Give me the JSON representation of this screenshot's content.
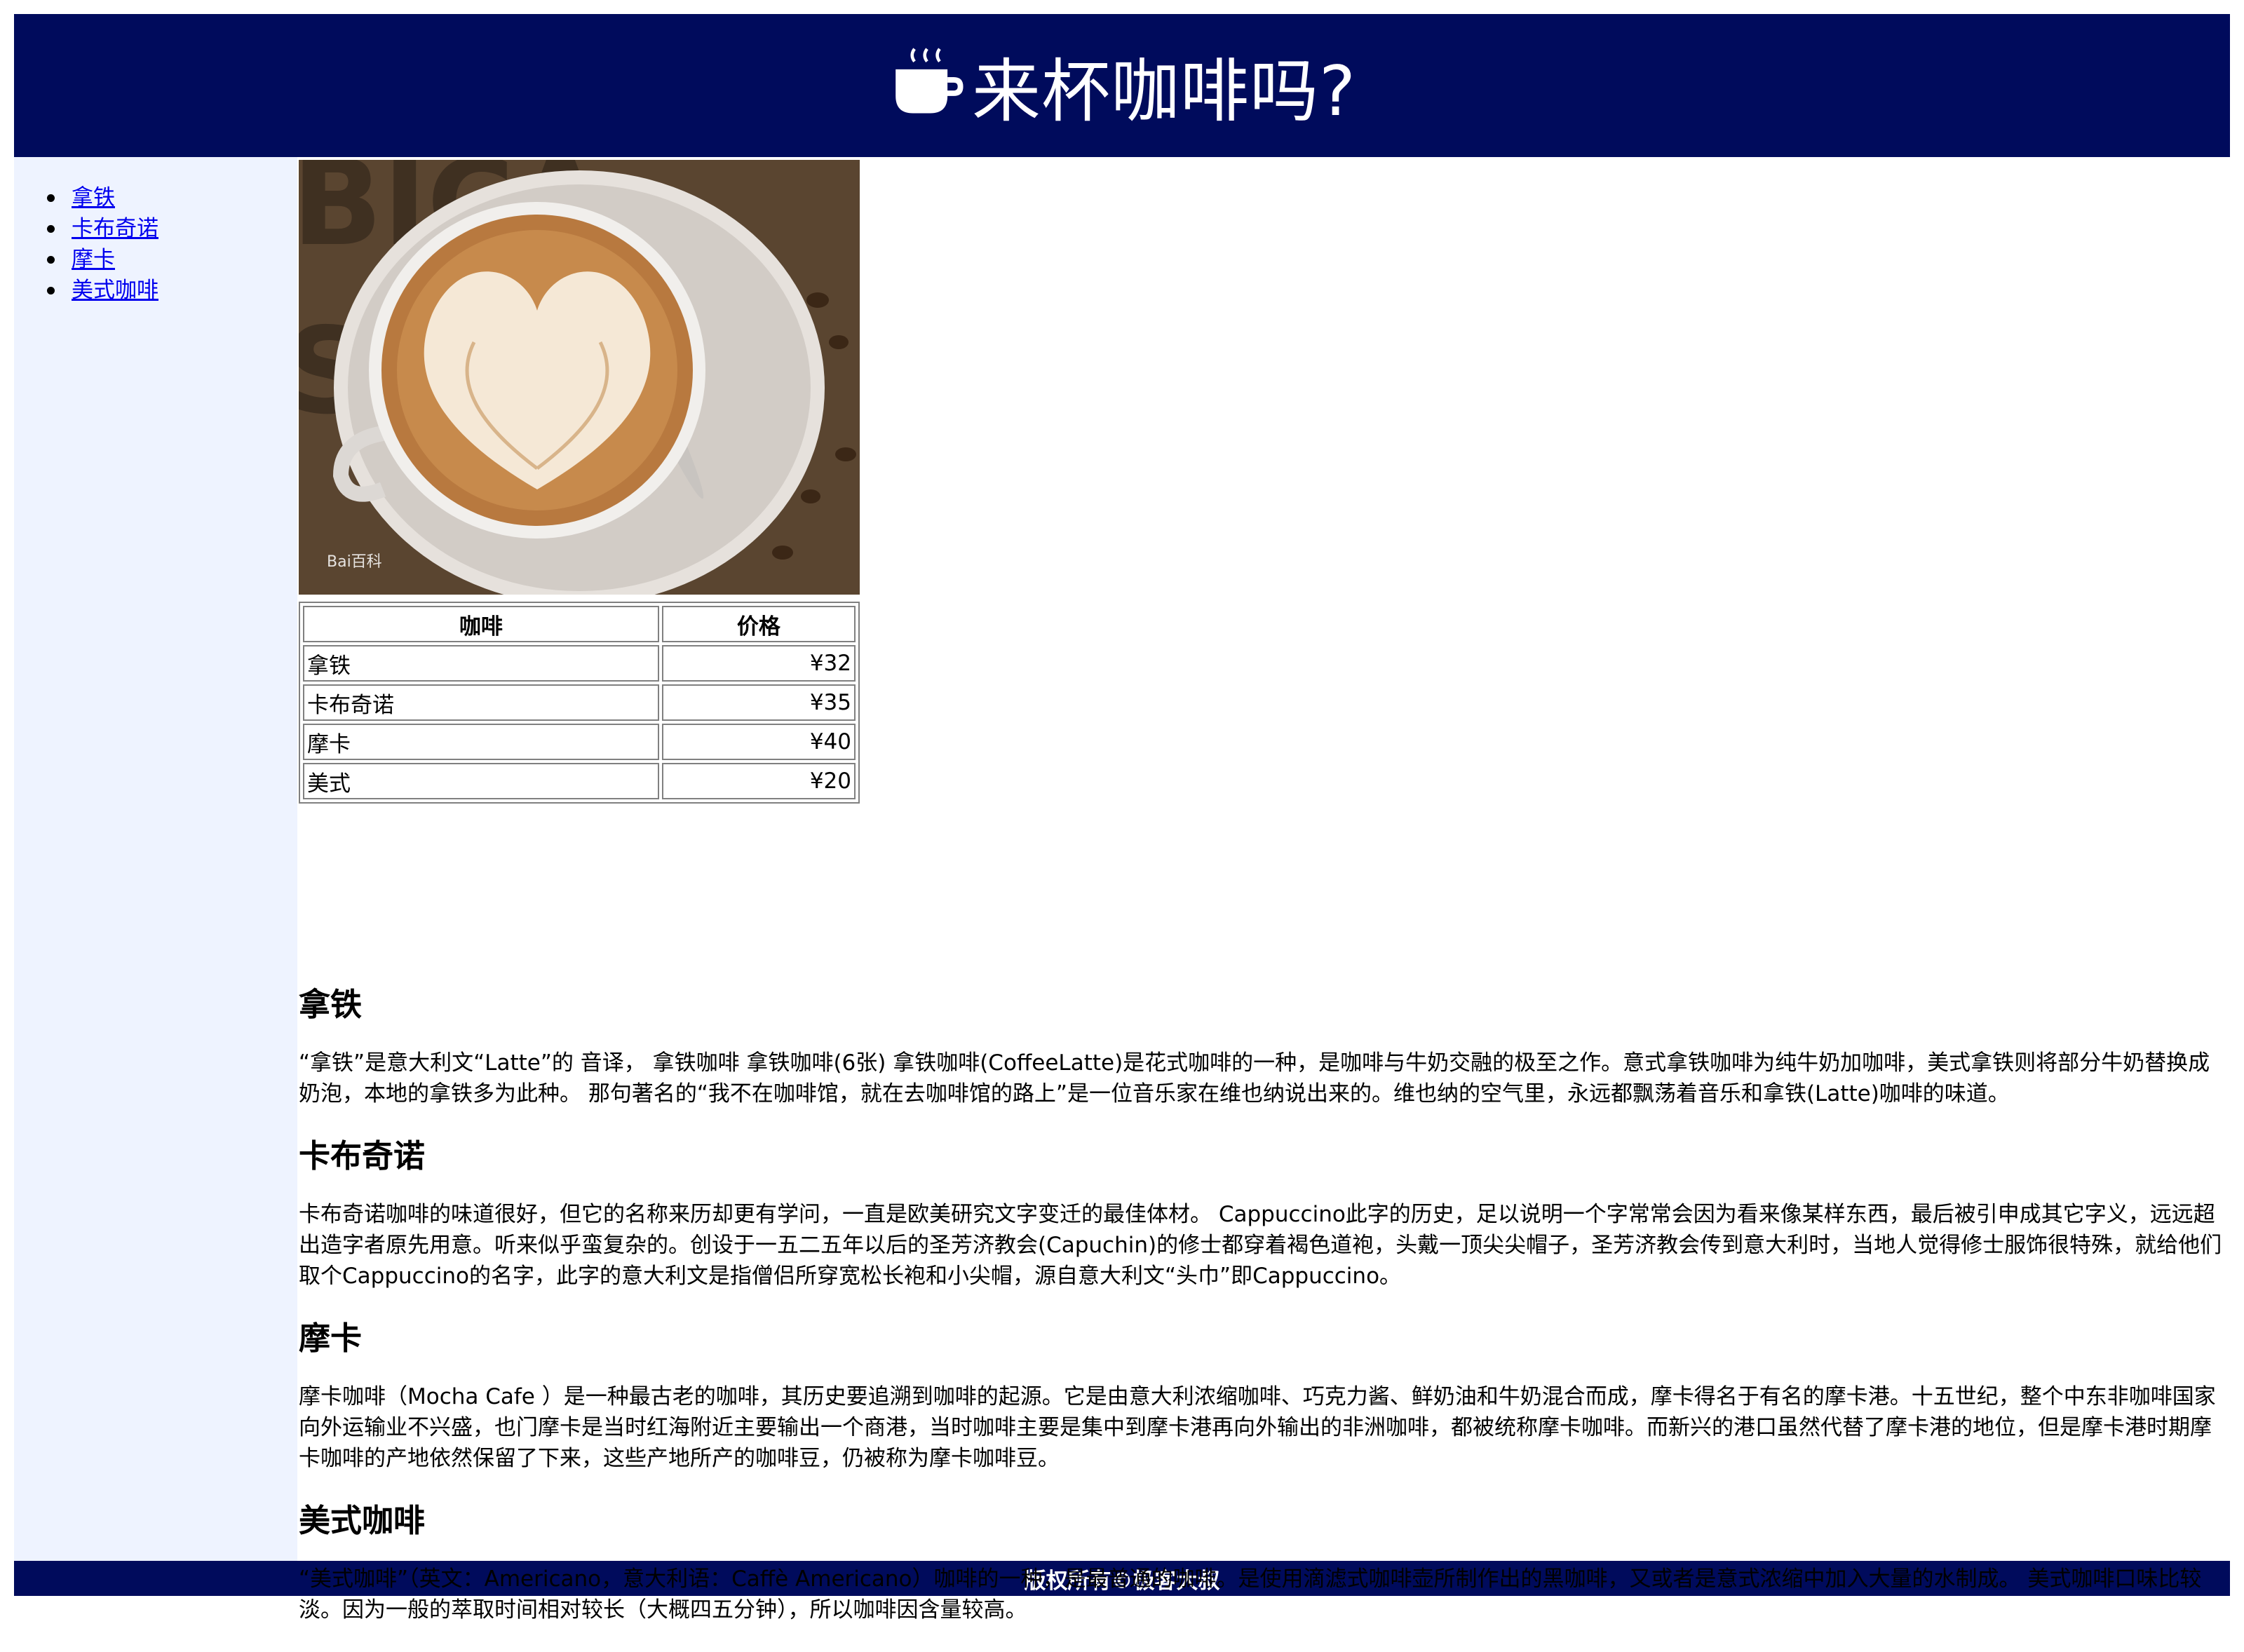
{
  "header": {
    "icon": "coffee-cup-icon",
    "title": "来杯咖啡吗?"
  },
  "sidebar": {
    "items": [
      {
        "label": "拿铁"
      },
      {
        "label": "卡布奇诺"
      },
      {
        "label": "摩卡"
      },
      {
        "label": "美式咖啡"
      }
    ]
  },
  "hero_image": {
    "watermark": "Bai百科"
  },
  "price_table": {
    "headers": [
      "咖啡",
      "价格"
    ],
    "rows": [
      [
        "拿铁",
        "¥32"
      ],
      [
        "卡布奇诺",
        "¥35"
      ],
      [
        "摩卡",
        "¥40"
      ],
      [
        "美式",
        "¥20"
      ]
    ]
  },
  "sections": [
    {
      "title": "拿铁",
      "text": "“拿铁”是意大利文“Latte”的 音译， 拿铁咖啡 拿铁咖啡(6张) 拿铁咖啡(CoffeeLatte)是花式咖啡的一种，是咖啡与牛奶交融的极至之作。意式拿铁咖啡为纯牛奶加咖啡，美式拿铁则将部分牛奶替换成奶泡，本地的拿铁多为此种。 那句著名的“我不在咖啡馆，就在去咖啡馆的路上”是一位音乐家在维也纳说出来的。维也纳的空气里，永远都飘荡着音乐和拿铁(Latte)咖啡的味道。"
    },
    {
      "title": "卡布奇诺",
      "text": "卡布奇诺咖啡的味道很好，但它的名称来历却更有学问，一直是欧美研究文字变迁的最佳体材。 Cappuccino此字的历史，足以说明一个字常常会因为看来像某样东西，最后被引申成其它字义，远远超出造字者原先用意。听来似乎蛮复杂的。创设于一五二五年以后的圣芳济教会(Capuchin)的修士都穿着褐色道袍，头戴一顶尖尖帽子，圣芳济教会传到意大利时，当地人觉得修士服饰很特殊，就给他们取个Cappuccino的名字，此字的意大利文是指僧侣所穿宽松长袍和小尖帽，源自意大利文“头巾”即Cappuccino。"
    },
    {
      "title": "摩卡",
      "text": "摩卡咖啡（Mocha Cafe ）是一种最古老的咖啡，其历史要追溯到咖啡的起源。它是由意大利浓缩咖啡、巧克力酱、鲜奶油和牛奶混合而成，摩卡得名于有名的摩卡港。十五世纪，整个中东非咖啡国家向外运输业不兴盛，也门摩卡是当时红海附近主要输出一个商港，当时咖啡主要是集中到摩卡港再向外输出的非洲咖啡，都被统称摩卡咖啡。而新兴的港口虽然代替了摩卡港的地位，但是摩卡港时期摩卡咖啡的产地依然保留了下来，这些产地所产的咖啡豆，仍被称为摩卡咖啡豆。"
    },
    {
      "title": "美式咖啡",
      "text": "“美式咖啡”（英文：Americano，意大利语：Caffè Americano）咖啡的一种，是最普通的咖啡。是使用滴滤式咖啡壶所制作出的黑咖啡，又或者是意式浓缩中加入大量的水制成。 美式咖啡口味比较淡。因为一般的萃取时间相对较长（大概四五分钟），所以咖啡因含量较高。"
    }
  ],
  "footer": {
    "text": "版权所有©极客大叔"
  },
  "colors": {
    "header_bg": "#000b5c",
    "sidebar_bg": "#eef3ff",
    "link": "#0000ee"
  }
}
